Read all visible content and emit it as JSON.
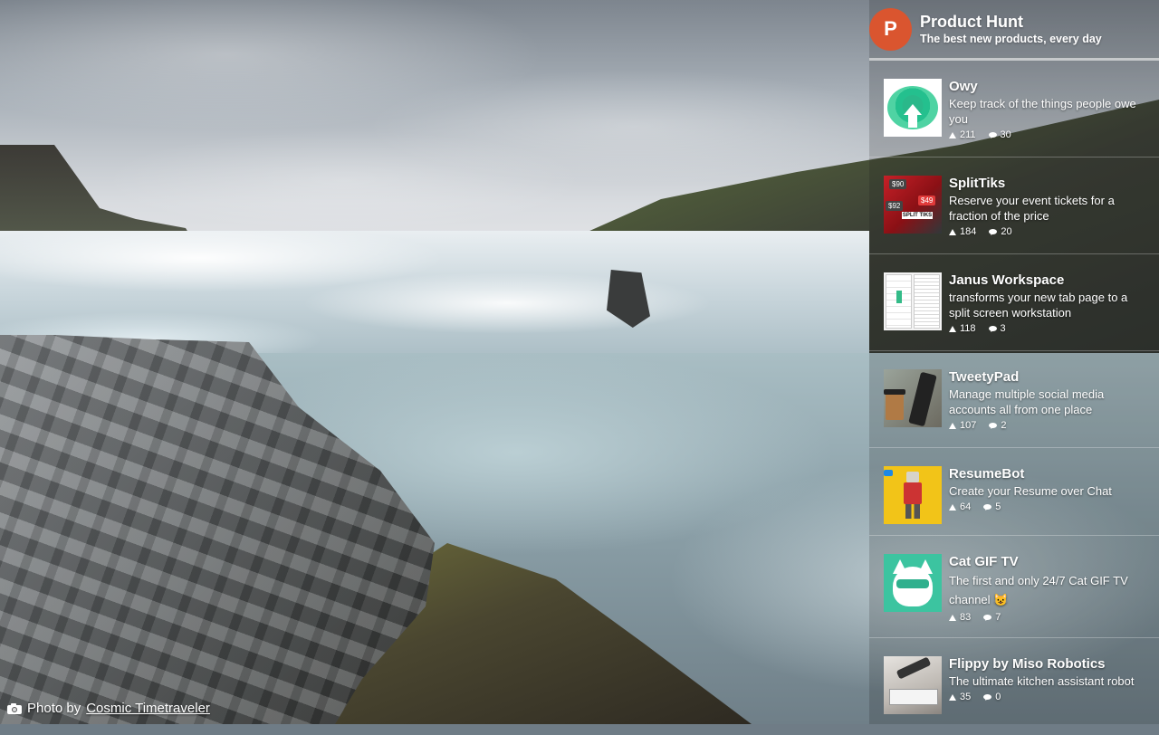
{
  "credit": {
    "prefix": "Photo by",
    "author": "Cosmic Timetraveler"
  },
  "product_hunt": {
    "logo_letter": "P",
    "title": "Product Hunt",
    "tagline": "The best new products, every day",
    "accent_color": "#da552f",
    "products": [
      {
        "name": "Owy",
        "description": "Keep track of the things people owe you",
        "upvotes": "211",
        "comments": "30",
        "thumb_icon": "owy-logo"
      },
      {
        "name": "SplitTiks",
        "description": "Reserve your event tickets for a fraction of the price",
        "upvotes": "184",
        "comments": "20",
        "thumb_icon": "splittiks-thumb"
      },
      {
        "name": "Janus Workspace",
        "description": "transforms your new tab page to a split screen workstation",
        "upvotes": "118",
        "comments": "3",
        "thumb_icon": "janus-thumb"
      },
      {
        "name": "TweetyPad",
        "description": "Manage multiple social media accounts all from one place",
        "upvotes": "107",
        "comments": "2",
        "thumb_icon": "tweetypad-thumb"
      },
      {
        "name": "ResumeBot",
        "description": "Create your Resume over Chat",
        "upvotes": "64",
        "comments": "5",
        "thumb_icon": "resumebot-thumb"
      },
      {
        "name": "Cat GIF TV",
        "description": "The first and only 24/7 Cat GIF TV channel 😺",
        "upvotes": "83",
        "comments": "7",
        "thumb_icon": "catgiftv-thumb"
      },
      {
        "name": "Flippy by Miso Robotics",
        "description": "The ultimate kitchen assistant robot",
        "upvotes": "35",
        "comments": "0",
        "thumb_icon": "flippy-thumb"
      }
    ]
  }
}
